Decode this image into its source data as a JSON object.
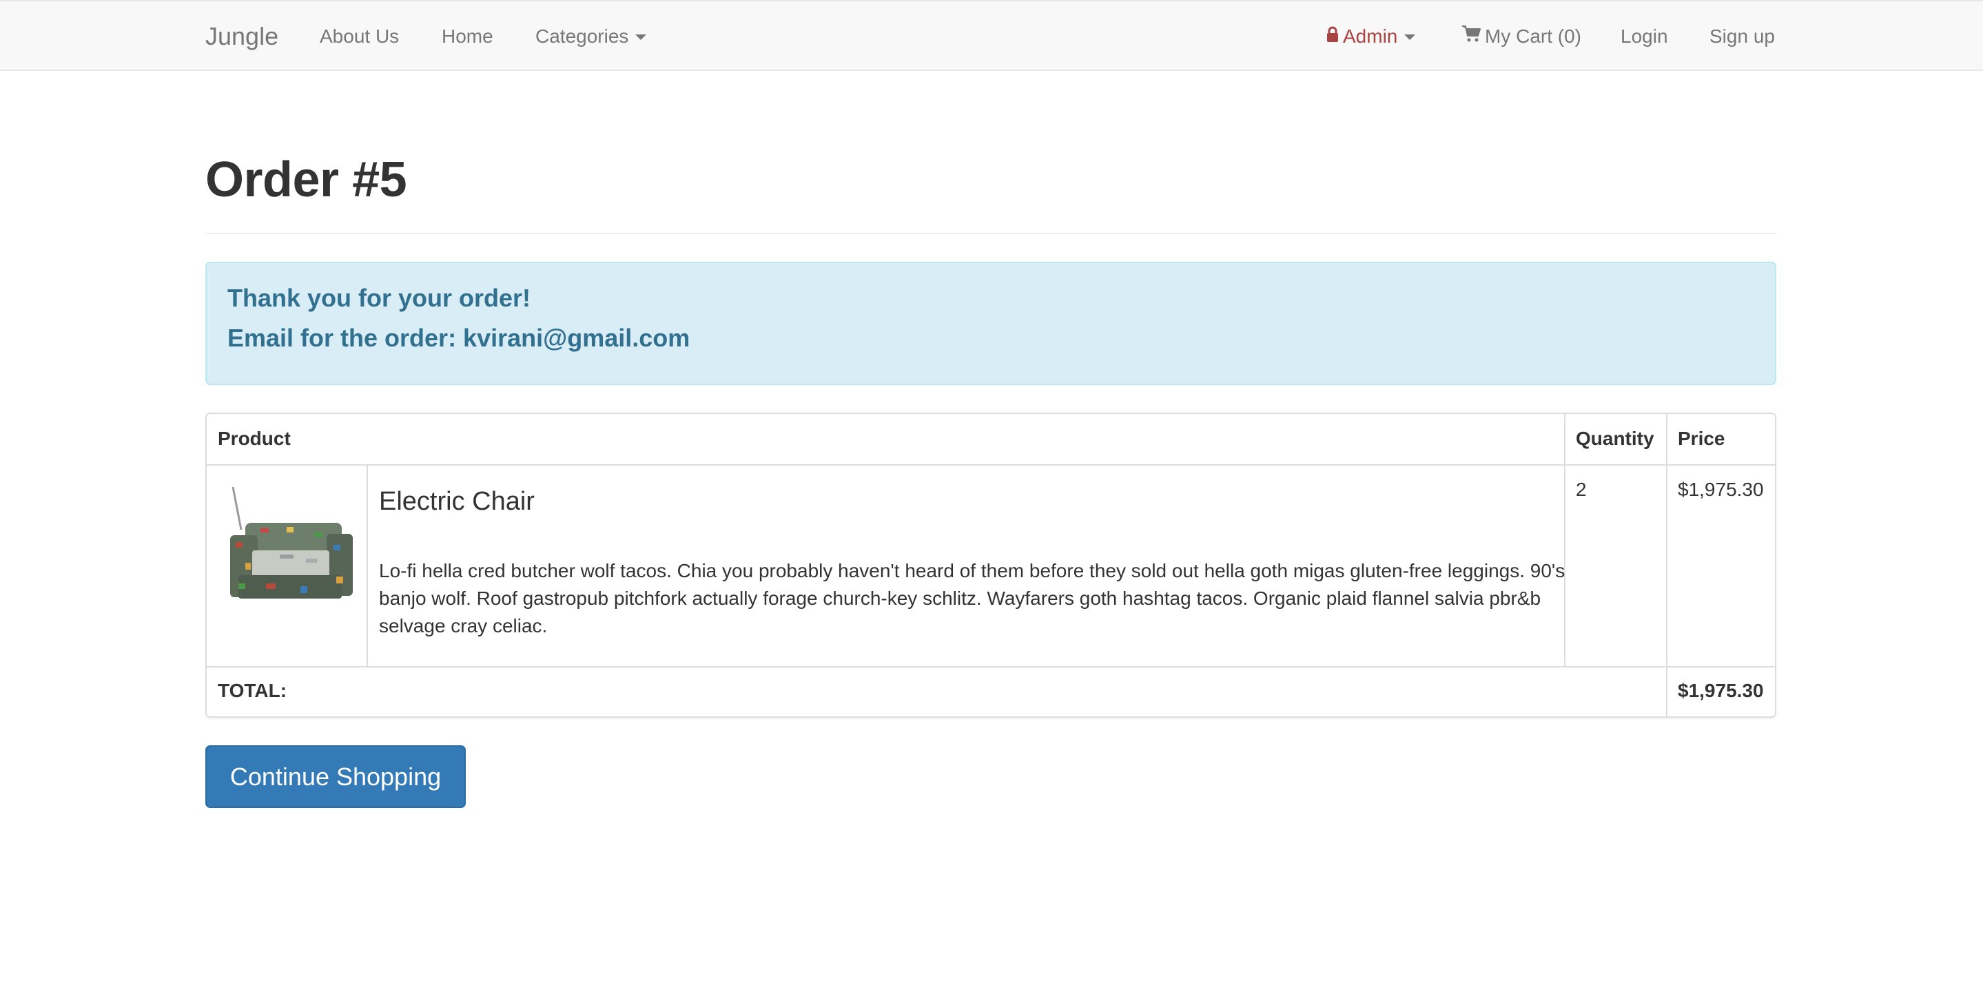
{
  "navbar": {
    "brand": "Jungle",
    "about": "About Us",
    "home": "Home",
    "categories": "Categories",
    "admin": "Admin",
    "cart": "My Cart (0)",
    "login": "Login",
    "signup": "Sign up",
    "icons": {
      "admin": "lock-icon",
      "cart": "shopping-cart-icon"
    },
    "colors": {
      "admin": "#a94442",
      "text": "#777777",
      "background": "#f8f8f8"
    }
  },
  "page": {
    "title": "Order #5"
  },
  "alert": {
    "thanks": "Thank you for your order!",
    "email_line": "Email for the order: kvirani@gmail.com",
    "colors": {
      "background": "#d9edf7",
      "text": "#31708f",
      "border": "#bce8f1"
    }
  },
  "table": {
    "headers": {
      "product": "Product",
      "quantity": "Quantity",
      "price": "Price"
    },
    "rows": [
      {
        "image": "electric-chair-image",
        "name": "Electric Chair",
        "description": "Lo-fi hella cred butcher wolf tacos. Chia you probably haven't heard of them before they sold out hella goth migas gluten-free leggings. 90's banjo wolf. Roof gastropub pitchfork actually forage church-key schlitz. Wayfarers goth hashtag tacos. Organic plaid flannel salvia pbr&b selvage cray celiac.",
        "quantity": "2",
        "price": "$1,975.30"
      }
    ],
    "total_label": "TOTAL:",
    "total_value": "$1,975.30"
  },
  "actions": {
    "continue": "Continue Shopping",
    "colors": {
      "primary": "#337ab7"
    }
  }
}
